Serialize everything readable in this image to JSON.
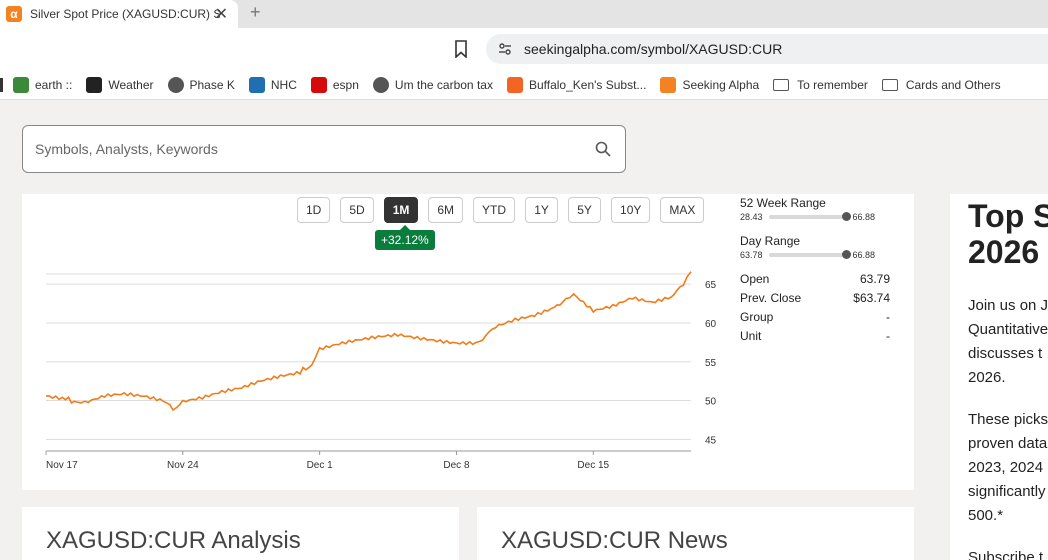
{
  "browser": {
    "tab_title": "Silver Spot Price (XAGUSD:CUR) S",
    "tab_close": "✕",
    "new_tab": "+",
    "url": "seekingalpha.com/symbol/XAGUSD:CUR"
  },
  "bookmarks": [
    {
      "label": "earth ::",
      "icon": "earth-icon",
      "color": "#3a8a3a"
    },
    {
      "label": "Weather",
      "icon": "weather-icon",
      "color": "#222222"
    },
    {
      "label": "Phase K",
      "icon": "globe-icon",
      "color": "#555555"
    },
    {
      "label": "NHC",
      "icon": "noaa-icon",
      "color": "#1f6fb2"
    },
    {
      "label": "espn",
      "icon": "espn-icon",
      "color": "#d50a0a"
    },
    {
      "label": "Um the carbon tax",
      "icon": "globe-icon",
      "color": "#555555"
    },
    {
      "label": "Buffalo_Ken's Subst...",
      "icon": "bookmark-icon",
      "color": "#f26522"
    },
    {
      "label": "Seeking Alpha",
      "icon": "seeking-alpha-icon",
      "color": "#f48220"
    },
    {
      "label": "To remember",
      "icon": "folder-icon",
      "color": "#555555"
    },
    {
      "label": "Cards and Others",
      "icon": "folder-icon",
      "color": "#555555"
    }
  ],
  "search": {
    "placeholder": "Symbols, Analysts, Keywords"
  },
  "periods": [
    "1D",
    "5D",
    "1M",
    "6M",
    "YTD",
    "1Y",
    "5Y",
    "10Y",
    "MAX"
  ],
  "active_period": "1M",
  "change_badge": "+32.12%",
  "stats": {
    "week52": {
      "label": "52 Week Range",
      "low": "28.43",
      "high": "66.88",
      "position": 1.0
    },
    "day": {
      "label": "Day Range",
      "low": "63.78",
      "high": "66.88",
      "position": 1.0
    },
    "rows": [
      {
        "label": "Open",
        "value": "63.79"
      },
      {
        "label": "Prev. Close",
        "value": "$63.74"
      },
      {
        "label": "Group",
        "value": "-"
      },
      {
        "label": "Unit",
        "value": "-"
      }
    ]
  },
  "chart_data": {
    "type": "line",
    "ylim": [
      43.5,
      68.5
    ],
    "yticks": [
      45,
      50,
      55,
      60,
      65
    ],
    "xlim": [
      0,
      33
    ],
    "xticks": [
      {
        "label": "Nov 17",
        "x": 0
      },
      {
        "label": "Nov 24",
        "x": 7
      },
      {
        "label": "Dec 1",
        "x": 14
      },
      {
        "label": "Dec 8",
        "x": 21
      },
      {
        "label": "Dec 15",
        "x": 28
      }
    ],
    "color": "#f07c1a",
    "x": [
      0,
      1,
      1.6,
      2,
      3,
      4,
      5,
      6,
      6.5,
      7,
      8,
      9,
      10,
      11,
      12,
      13,
      13.6,
      14,
      15,
      16,
      17,
      18,
      19,
      20,
      21,
      22,
      22.5,
      23,
      24,
      25,
      26,
      26.6,
      27,
      28,
      29,
      30,
      31,
      32,
      32.6,
      33
    ],
    "values": [
      50.6,
      50.3,
      49.6,
      49.9,
      50.8,
      51.0,
      50.6,
      49.9,
      48.8,
      49.7,
      50.2,
      51.0,
      51.6,
      52.6,
      53.3,
      53.8,
      54.4,
      56.8,
      57.4,
      57.8,
      58.1,
      58.3,
      57.9,
      57.6,
      57.4,
      57.5,
      58.4,
      59.7,
      60.6,
      61.1,
      62.0,
      62.9,
      63.6,
      61.4,
      62.0,
      63.1,
      62.6,
      63.4,
      65.0,
      66.6
    ]
  },
  "promo": {
    "title_line1": "Top S",
    "title_line2": "2026",
    "para1": [
      "Join us on J",
      "Quantitative",
      "discusses t",
      "2026."
    ],
    "para2": [
      "These picks",
      "proven data",
      "2023, 2024",
      "significantly",
      "500.*"
    ],
    "para3": [
      "Subscribe t"
    ]
  },
  "cards": {
    "analysis_title": "XAGUSD:CUR Analysis",
    "news_title": "XAGUSD:CUR News"
  }
}
